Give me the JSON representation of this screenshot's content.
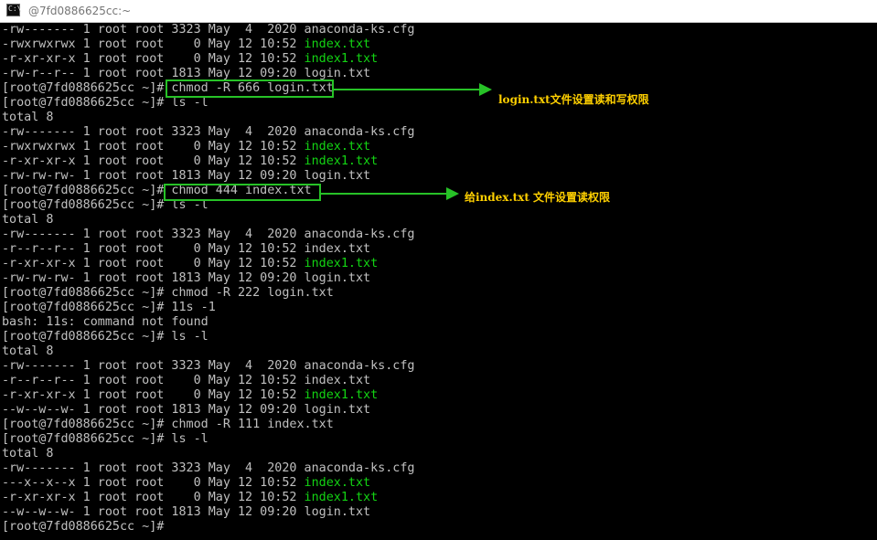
{
  "window": {
    "title": "@7fd0886625cc:~",
    "icon": "console-icon",
    "icon_glyph": "C:\\"
  },
  "terminal": {
    "lines": [
      [
        {
          "t": "-rw------- 1 root root 3323 May  4  2020 anaconda-ks.cfg"
        }
      ],
      [
        {
          "t": "-rwxrwxrwx 1 root root    0 May 12 10:52 "
        },
        {
          "t": "index.txt",
          "c": "g"
        }
      ],
      [
        {
          "t": "-r-xr-xr-x 1 root root    0 May 12 10:52 "
        },
        {
          "t": "index1.txt",
          "c": "g"
        }
      ],
      [
        {
          "t": "-rw-r--r-- 1 root root 1813 May 12 09:20 login.txt"
        }
      ],
      [
        {
          "t": "[root@7fd0886625cc ~]# chmod -R 666 login.txt"
        }
      ],
      [
        {
          "t": "[root@7fd0886625cc ~]# ls -l"
        }
      ],
      [
        {
          "t": "total 8"
        }
      ],
      [
        {
          "t": "-rw------- 1 root root 3323 May  4  2020 anaconda-ks.cfg"
        }
      ],
      [
        {
          "t": "-rwxrwxrwx 1 root root    0 May 12 10:52 "
        },
        {
          "t": "index.txt",
          "c": "g"
        }
      ],
      [
        {
          "t": "-r-xr-xr-x 1 root root    0 May 12 10:52 "
        },
        {
          "t": "index1.txt",
          "c": "g"
        }
      ],
      [
        {
          "t": "-rw-rw-rw- 1 root root 1813 May 12 09:20 login.txt"
        }
      ],
      [
        {
          "t": "[root@7fd0886625cc ~]# chmod 444 index.txt"
        }
      ],
      [
        {
          "t": "[root@7fd0886625cc ~]# ls -l"
        }
      ],
      [
        {
          "t": "total 8"
        }
      ],
      [
        {
          "t": "-rw------- 1 root root 3323 May  4  2020 anaconda-ks.cfg"
        }
      ],
      [
        {
          "t": "-r--r--r-- 1 root root    0 May 12 10:52 index.txt"
        }
      ],
      [
        {
          "t": "-r-xr-xr-x 1 root root    0 May 12 10:52 "
        },
        {
          "t": "index1.txt",
          "c": "g"
        }
      ],
      [
        {
          "t": "-rw-rw-rw- 1 root root 1813 May 12 09:20 login.txt"
        }
      ],
      [
        {
          "t": "[root@7fd0886625cc ~]# chmod -R 222 login.txt"
        }
      ],
      [
        {
          "t": "[root@7fd0886625cc ~]# 11s -1"
        }
      ],
      [
        {
          "t": "bash: 11s: command not found"
        }
      ],
      [
        {
          "t": "[root@7fd0886625cc ~]# ls -l"
        }
      ],
      [
        {
          "t": "total 8"
        }
      ],
      [
        {
          "t": "-rw------- 1 root root 3323 May  4  2020 anaconda-ks.cfg"
        }
      ],
      [
        {
          "t": "-r--r--r-- 1 root root    0 May 12 10:52 index.txt"
        }
      ],
      [
        {
          "t": "-r-xr-xr-x 1 root root    0 May 12 10:52 "
        },
        {
          "t": "index1.txt",
          "c": "g"
        }
      ],
      [
        {
          "t": "--w--w--w- 1 root root 1813 May 12 09:20 login.txt"
        }
      ],
      [
        {
          "t": "[root@7fd0886625cc ~]# chmod -R 111 index.txt"
        }
      ],
      [
        {
          "t": "[root@7fd0886625cc ~]# ls -l"
        }
      ],
      [
        {
          "t": "total 8"
        }
      ],
      [
        {
          "t": "-rw------- 1 root root 3323 May  4  2020 anaconda-ks.cfg"
        }
      ],
      [
        {
          "t": "---x--x--x 1 root root    0 May 12 10:52 "
        },
        {
          "t": "index.txt",
          "c": "g"
        }
      ],
      [
        {
          "t": "-r-xr-xr-x 1 root root    0 May 12 10:52 "
        },
        {
          "t": "index1.txt",
          "c": "g"
        }
      ],
      [
        {
          "t": "--w--w--w- 1 root root 1813 May 12 09:20 login.txt"
        }
      ],
      [
        {
          "t": "[root@7fd0886625cc ~]#"
        }
      ]
    ]
  },
  "annotations": {
    "first": "login.txt文件设置读和写权限",
    "second": "给index.txt 文件设置读权限"
  },
  "colors": {
    "background": "#000000",
    "text": "#c0c0c0",
    "executable": "#13d313",
    "annotation_box": "#27c227",
    "annotation_text": "#ffd000"
  }
}
